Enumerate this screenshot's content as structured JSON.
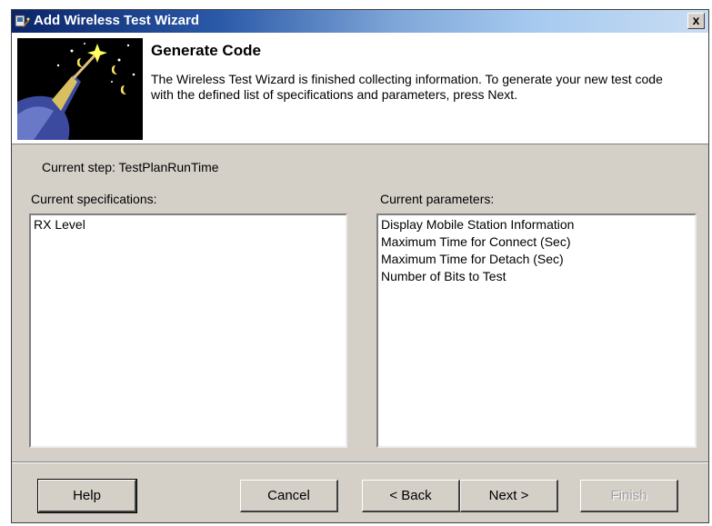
{
  "window": {
    "title": "Add Wireless Test Wizard",
    "close_label": "x"
  },
  "header": {
    "title": "Generate Code",
    "description": "The Wireless Test Wizard is finished collecting information.  To generate your new test code with the defined list of specifications and parameters, press Next."
  },
  "current_step": "Current step: TestPlanRunTime",
  "specifications": {
    "label": "Current specifications:",
    "items": [
      "RX Level"
    ]
  },
  "parameters": {
    "label": "Current parameters:",
    "items": [
      "Display Mobile Station Information",
      "Maximum Time for Connect (Sec)",
      "Maximum Time for Detach (Sec)",
      "Number of Bits to Test"
    ]
  },
  "buttons": {
    "help": "Help",
    "cancel": "Cancel",
    "back": "< Back",
    "next": "Next >",
    "finish": "Finish"
  },
  "colors": {
    "title_bar_start": "#0a246a",
    "title_bar_end": "#c9dcf2",
    "dialog_face": "#d4d0c8"
  },
  "icons": {
    "app": "wizard-app-icon",
    "banner": "wizard-wand-icon"
  }
}
